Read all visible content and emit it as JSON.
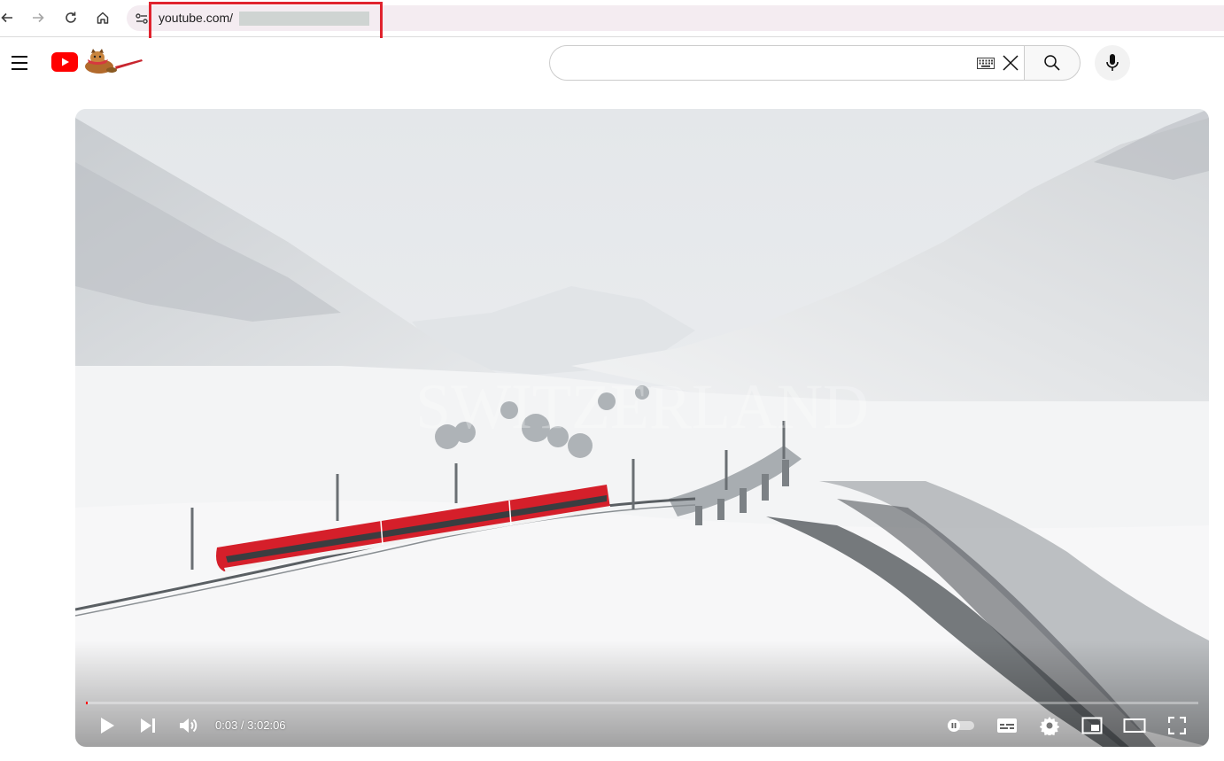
{
  "browser": {
    "url": "youtube.com/"
  },
  "youtube": {
    "search": {
      "placeholder": ""
    }
  },
  "player": {
    "current_time": "0:03",
    "duration": "3:02:06",
    "time_separator": " / ",
    "progress_fraction": 0.0003,
    "watermark_text": "SWITZERLAND",
    "icons": [
      "play-icon",
      "next-icon",
      "volume-icon",
      "autoplay-toggle-icon",
      "subtitles-icon",
      "settings-icon",
      "miniplayer-icon",
      "theater-mode-icon",
      "fullscreen-icon"
    ]
  },
  "colors": {
    "highlight": "#e0232e",
    "youtube_red": "#ff0000",
    "train_red": "#d51f2a"
  }
}
